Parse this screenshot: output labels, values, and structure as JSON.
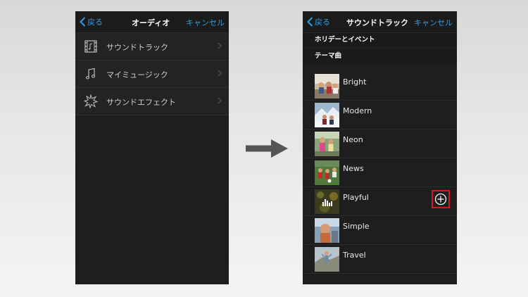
{
  "left_screen": {
    "back_label": "戻る",
    "title": "オーディオ",
    "cancel_label": "キャンセル",
    "menu": [
      {
        "label": "サウンドトラック",
        "icon": "film-music-icon"
      },
      {
        "label": "マイミュージック",
        "icon": "music-note-icon"
      },
      {
        "label": "サウンドエフェクト",
        "icon": "burst-icon"
      }
    ]
  },
  "right_screen": {
    "back_label": "戻る",
    "title": "サウンドトラック",
    "cancel_label": "キャンセル",
    "section_holiday": "ホリデーとイベント",
    "section_theme": "テーマ曲",
    "tracks": [
      {
        "name": "Bright"
      },
      {
        "name": "Modern"
      },
      {
        "name": "Neon"
      },
      {
        "name": "News"
      },
      {
        "name": "Playful",
        "highlighted_add": true
      },
      {
        "name": "Simple"
      },
      {
        "name": "Travel"
      }
    ]
  },
  "colors": {
    "accent": "#2f9be0",
    "highlight": "#e0141a",
    "arrow": "#555555"
  }
}
